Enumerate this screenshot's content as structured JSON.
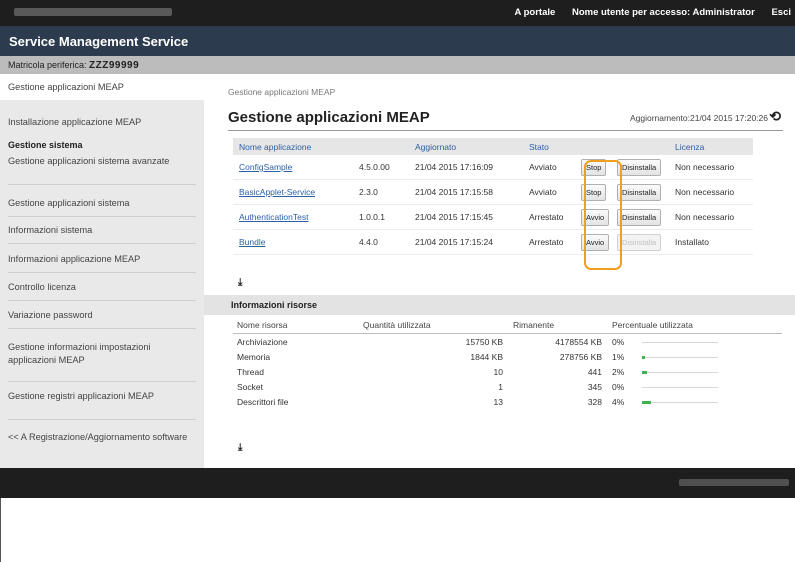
{
  "header": {
    "portal_link": "A portale",
    "user_prefix": "Nome utente per accesso:",
    "user_name": "Administrator",
    "exit_link": "Esci"
  },
  "title": "Service Management Service",
  "serial": {
    "label": "Matricola periferica:",
    "value": "ZZZ99999"
  },
  "sidebar": {
    "items": [
      "Gestione applicazioni MEAP",
      "Installazione applicazione MEAP"
    ],
    "section_title": "Gestione sistema",
    "system_items": [
      "Gestione applicazioni sistema avanzate",
      "Gestione applicazioni sistema",
      "Informazioni sistema",
      "Informazioni applicazione MEAP",
      "Controllo licenza",
      "Variazione password",
      "Gestione informazioni impostazioni applicazioni MEAP",
      "Gestione registri applicazioni MEAP"
    ],
    "back_link": "<< A Registrazione/Aggiornamento software"
  },
  "main": {
    "breadcrumb": "Gestione applicazioni MEAP",
    "page_title": "Gestione applicazioni MEAP",
    "updated_label": "Aggiornamento:",
    "updated_value": "21/04 2015 17:20:26",
    "apps_headers": [
      "Nome applicazione",
      "Aggiornato",
      "Stato",
      "Licenza"
    ],
    "apps": [
      {
        "name": "ConfigSample",
        "version": "4.5.0.00",
        "updated": "21/04 2015 17:16:09",
        "status": "Avviato",
        "action": "Stop",
        "uninstall": "Disinstalla",
        "uninstall_enabled": true,
        "license": "Non necessario"
      },
      {
        "name": "BasicApplet-Service",
        "version": "2.3.0",
        "updated": "21/04 2015 17:15:58",
        "status": "Avviato",
        "action": "Stop",
        "uninstall": "Disinstalla",
        "uninstall_enabled": true,
        "license": "Non necessario"
      },
      {
        "name": "AuthenticationTest",
        "version": "1.0.0.1",
        "updated": "21/04 2015 17:15:45",
        "status": "Arrestato",
        "action": "Avvio",
        "uninstall": "Disinstalla",
        "uninstall_enabled": true,
        "license": "Non necessario"
      },
      {
        "name": "Bundle",
        "version": "4.4.0",
        "updated": "21/04 2015 17:15:24",
        "status": "Arrestato",
        "action": "Avvio",
        "uninstall": "Disinstalla",
        "uninstall_enabled": false,
        "license": "Installato"
      }
    ],
    "resources_title": "Informazioni risorse",
    "res_headers": [
      "Nome risorsa",
      "Quantità utilizzata",
      "Rimanente",
      "Percentuale utilizzata"
    ],
    "resources": [
      {
        "name": "Archiviazione",
        "used": "15750 KB",
        "remaining": "4178554 KB",
        "percent": "0%",
        "fill": 0.0
      },
      {
        "name": "Memoria",
        "used": "1844 KB",
        "remaining": "278756 KB",
        "percent": "1%",
        "fill": 0.01
      },
      {
        "name": "Thread",
        "used": "10",
        "remaining": "441",
        "percent": "2%",
        "fill": 0.02
      },
      {
        "name": "Socket",
        "used": "1",
        "remaining": "345",
        "percent": "0%",
        "fill": 0.0
      },
      {
        "name": "Descrittori file",
        "used": "13",
        "remaining": "328",
        "percent": "4%",
        "fill": 0.04
      }
    ]
  },
  "icons": {
    "refresh": "refresh-icon",
    "scroll_bottom": "scroll-to-bottom-icon"
  },
  "colors": {
    "highlight": "#f0a020",
    "link": "#2b5fa6",
    "title_bar": "#2c3c4e",
    "progress": "#3db24d"
  }
}
